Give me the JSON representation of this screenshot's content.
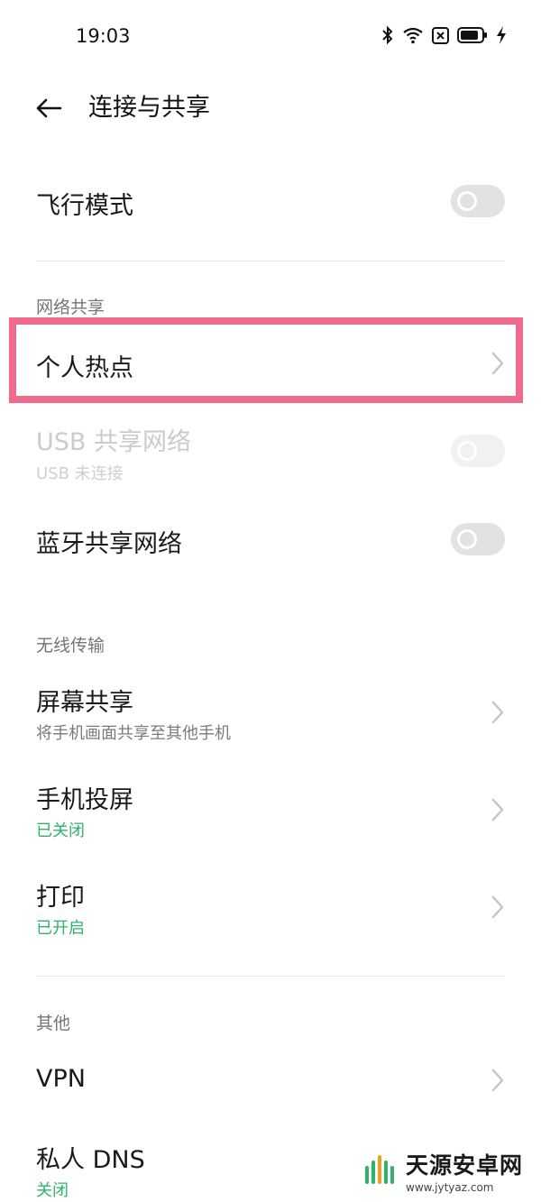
{
  "status_bar": {
    "time": "19:03"
  },
  "header": {
    "title": "连接与共享"
  },
  "airplane": {
    "label": "飞行模式"
  },
  "sections": {
    "tethering": "网络共享",
    "wireless": "无线传输",
    "other": "其他"
  },
  "hotspot": {
    "label": "个人热点"
  },
  "usb_tethering": {
    "label": "USB 共享网络",
    "sub": "USB 未连接"
  },
  "bt_tethering": {
    "label": "蓝牙共享网络"
  },
  "screen_share": {
    "label": "屏幕共享",
    "sub": "将手机画面共享至其他手机"
  },
  "cast": {
    "label": "手机投屏",
    "sub": "已关闭"
  },
  "print": {
    "label": "打印",
    "sub": "已开启"
  },
  "vpn": {
    "label": "VPN"
  },
  "private_dns": {
    "label": "私人 DNS",
    "sub": "关闭"
  },
  "watermark": {
    "name": "天源安卓网",
    "url": "www.jytyaz.com"
  },
  "colors": {
    "accent_green": "#2fb36a",
    "highlight": "#f06a8e"
  }
}
